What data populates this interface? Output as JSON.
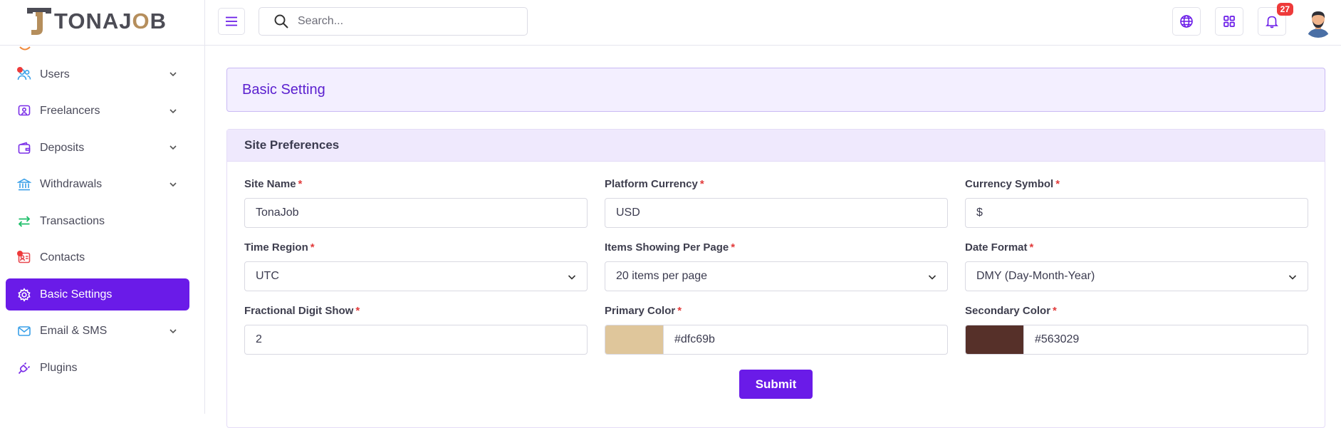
{
  "brand": {
    "name_prefix": "TONAJ",
    "name_o": "O",
    "name_suffix": "B"
  },
  "header": {
    "search_placeholder": "Search...",
    "notification_count": "27"
  },
  "sidebar": {
    "items": [
      {
        "label": "Users",
        "icon": "users-icon",
        "has_chevron": true,
        "dot": true
      },
      {
        "label": "Freelancers",
        "icon": "freelancer-icon",
        "has_chevron": true
      },
      {
        "label": "Deposits",
        "icon": "wallet-icon",
        "has_chevron": true
      },
      {
        "label": "Withdrawals",
        "icon": "bank-icon",
        "has_chevron": true
      },
      {
        "label": "Transactions",
        "icon": "transfer-icon",
        "has_chevron": false
      },
      {
        "label": "Contacts",
        "icon": "contacts-icon",
        "has_chevron": false,
        "dot": true
      },
      {
        "label": "Basic Settings",
        "icon": "gear-icon",
        "has_chevron": false,
        "active": true
      },
      {
        "label": "Email & SMS",
        "icon": "mail-icon",
        "has_chevron": true
      },
      {
        "label": "Plugins",
        "icon": "plug-icon",
        "has_chevron": false
      }
    ]
  },
  "page": {
    "title": "Basic Setting",
    "panel_title": "Site Preferences",
    "required_mark": "*",
    "fields": {
      "site_name": {
        "label": "Site Name",
        "value": "TonaJob"
      },
      "platform_currency": {
        "label": "Platform Currency",
        "value": "USD"
      },
      "currency_symbol": {
        "label": "Currency Symbol",
        "value": "$"
      },
      "time_region": {
        "label": "Time Region",
        "value": "UTC"
      },
      "items_per_page": {
        "label": "Items Showing Per Page",
        "value": "20 items per page"
      },
      "date_format": {
        "label": "Date Format",
        "value": "DMY (Day-Month-Year)"
      },
      "fractional_digit": {
        "label": "Fractional Digit Show",
        "value": "2"
      },
      "primary_color": {
        "label": "Primary Color",
        "value": "#dfc69b"
      },
      "secondary_color": {
        "label": "Secondary Color",
        "value": "#563029"
      }
    },
    "submit_label": "Submit"
  },
  "colors": {
    "accent": "#6a1be8",
    "primary_swatch": "#dfc69b",
    "secondary_swatch": "#563029",
    "badge": "#ee3a3a"
  }
}
